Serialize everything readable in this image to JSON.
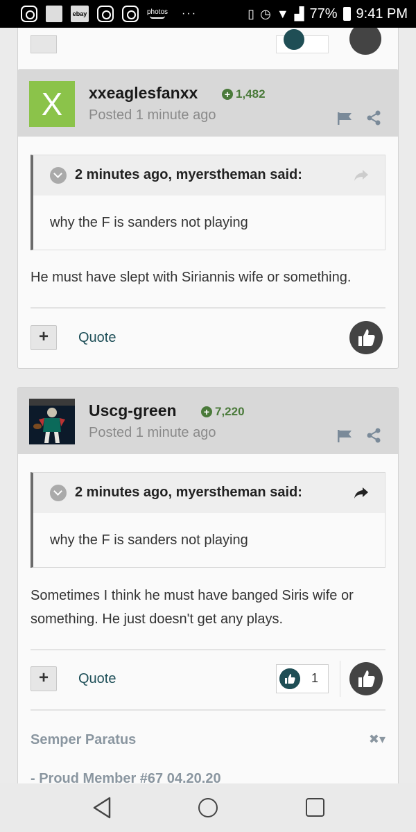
{
  "status_bar": {
    "ebay_label": "ebay",
    "photos_label": "photos",
    "overflow": "···",
    "battery": "77%",
    "time": "9:41 PM"
  },
  "posts": [
    {
      "username": "xxeaglesfanxx",
      "reputation": "1,482",
      "posted": "Posted 1 minute ago",
      "avatar_letter": "X",
      "avatar_color": "#8bc34a",
      "quote_cite": "2 minutes ago, myerstheman said:",
      "quote_text": "why the F is sanders not playing",
      "text": "He must have slept with Siriannis wife or something.",
      "quote_label": "Quote"
    },
    {
      "username": "Uscg-green",
      "reputation": "7,220",
      "posted": "Posted 1 minute ago",
      "quote_cite": "2 minutes ago, myerstheman said:",
      "quote_text": "why the F is sanders not playing",
      "text": "Sometimes I think he must have banged Siris wife or something. He just doesn't get any plays.",
      "quote_label": "Quote",
      "like_count": "1",
      "signature_title": "Semper Paratus",
      "signature_line": "-  Proud Member #67 04.20.20"
    }
  ],
  "colors": {
    "reputation": "#4a7a3a",
    "link": "#1e4f58",
    "like_bg": "#444444",
    "header_bg": "#d8d8d8"
  }
}
